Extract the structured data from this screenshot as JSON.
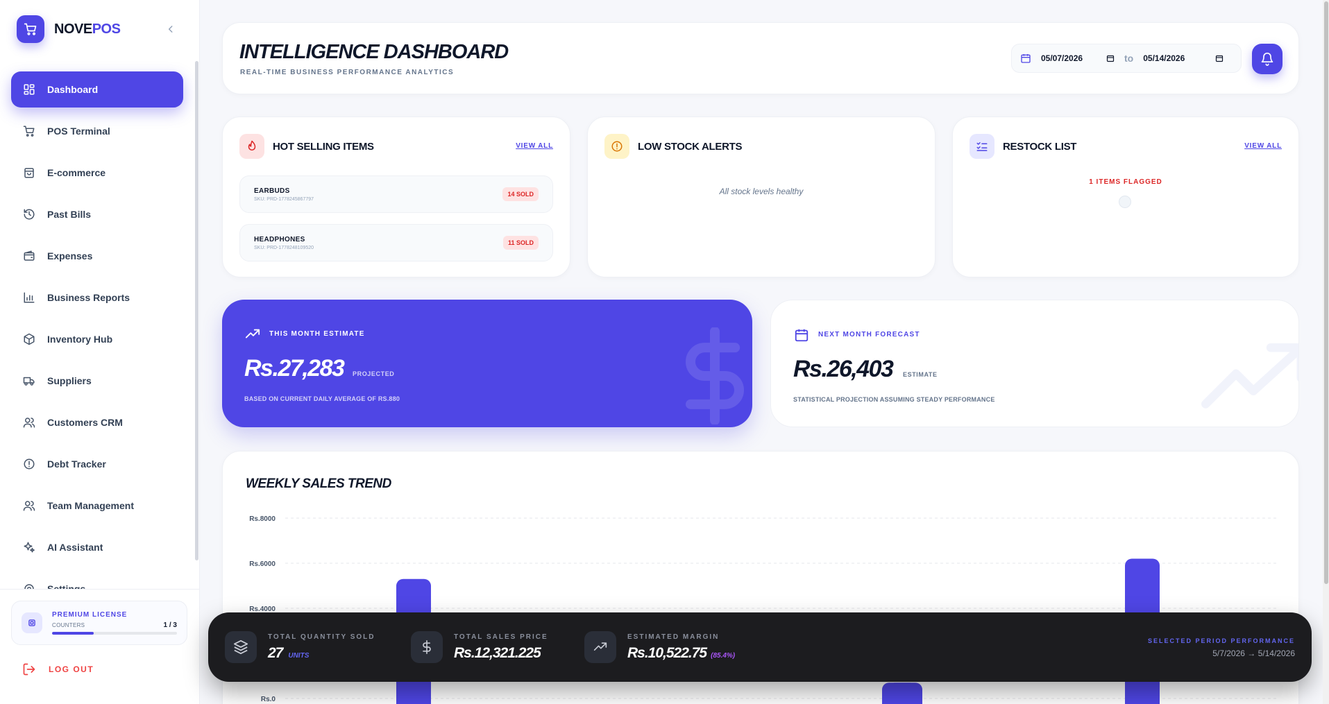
{
  "brand": {
    "name_main": "NOVE",
    "name_accent": "POS"
  },
  "sidebar": {
    "items": [
      {
        "label": "Dashboard",
        "icon": "dashboard-icon",
        "active": true
      },
      {
        "label": "POS Terminal",
        "icon": "cart-icon"
      },
      {
        "label": "E-commerce",
        "icon": "shopping-bag-icon"
      },
      {
        "label": "Past Bills",
        "icon": "history-icon"
      },
      {
        "label": "Expenses",
        "icon": "wallet-icon"
      },
      {
        "label": "Business Reports",
        "icon": "bar-chart-icon"
      },
      {
        "label": "Inventory Hub",
        "icon": "package-icon"
      },
      {
        "label": "Suppliers",
        "icon": "truck-icon"
      },
      {
        "label": "Customers CRM",
        "icon": "users-icon"
      },
      {
        "label": "Debt Tracker",
        "icon": "alert-circle-icon"
      },
      {
        "label": "Team Management",
        "icon": "team-icon"
      },
      {
        "label": "AI Assistant",
        "icon": "sparkles-icon"
      },
      {
        "label": "Settings",
        "icon": "settings-icon"
      }
    ],
    "license": {
      "title": "PREMIUM LICENSE",
      "subtitle": "COUNTERS",
      "count": "1 / 3",
      "used": 1,
      "total": 3
    },
    "logout_label": "LOG OUT"
  },
  "header": {
    "title": "INTELLIGENCE DASHBOARD",
    "subtitle": "REAL-TIME BUSINESS PERFORMANCE ANALYTICS",
    "date_from": "05/07/2026",
    "date_to": "05/14/2026",
    "to_label": "to"
  },
  "hot_selling": {
    "title": "HOT SELLING ITEMS",
    "view_all": "VIEW ALL",
    "items": [
      {
        "name": "EARBUDS",
        "sku": "SKU: PRD-1778245867797",
        "sold": "14 SOLD"
      },
      {
        "name": "HEADPHONES",
        "sku": "SKU: PRD-1778248109520",
        "sold": "11 SOLD"
      }
    ]
  },
  "low_stock": {
    "title": "LOW STOCK ALERTS",
    "empty_text": "All stock levels healthy"
  },
  "restock": {
    "title": "RESTOCK LIST",
    "view_all": "VIEW ALL",
    "flagged": "1 ITEMS FLAGGED"
  },
  "this_month": {
    "label": "THIS MONTH ESTIMATE",
    "value": "Rs.27,283",
    "tag": "PROJECTED",
    "note": "BASED ON CURRENT DAILY AVERAGE OF RS.880"
  },
  "next_month": {
    "label": "NEXT MONTH FORECAST",
    "value": "Rs.26,403",
    "tag": "ESTIMATE",
    "note": "STATISTICAL PROJECTION ASSUMING STEADY PERFORMANCE"
  },
  "weekly_trend": {
    "title": "WEEKLY SALES TREND"
  },
  "chart_data": {
    "type": "bar",
    "title": "WEEKLY SALES TREND",
    "ylim": [
      0,
      8000
    ],
    "y_ticks": [
      {
        "value": 8000,
        "label": "Rs.8000"
      },
      {
        "value": 6000,
        "label": "Rs.6000"
      },
      {
        "value": 4000,
        "label": "Rs.4000"
      },
      {
        "value": 0,
        "label": "Rs.0"
      }
    ],
    "grid": true,
    "values": [
      5300,
      0,
      700,
      6200
    ],
    "slots": [
      1,
      2,
      3,
      4
    ]
  },
  "summary": {
    "qty_label": "TOTAL QUANTITY SOLD",
    "qty_value": "27",
    "qty_unit": "UNITS",
    "sales_label": "TOTAL SALES PRICE",
    "sales_value": "Rs.12,321.225",
    "margin_label": "ESTIMATED MARGIN",
    "margin_value": "Rs.10,522.75",
    "margin_pct": "(85.4%)",
    "period_label": "SELECTED PERIOD PERFORMANCE",
    "period_from": "5/7/2026",
    "period_to": "5/14/2026"
  },
  "colors": {
    "accent": "#4f46e5",
    "danger": "#dc2626",
    "dark": "#1c1c1f"
  }
}
